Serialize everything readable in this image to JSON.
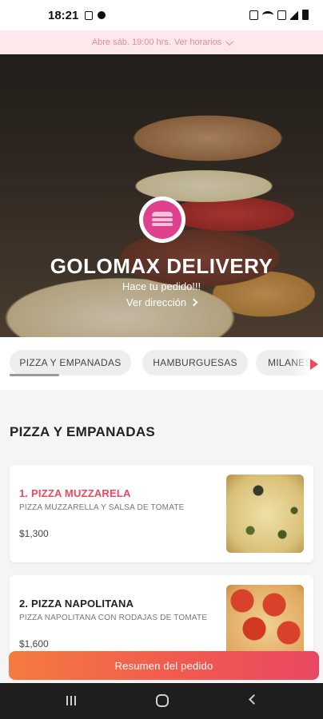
{
  "status_bar": {
    "time": "18:21"
  },
  "hours_bar": {
    "text": "Abre sáb. 19:00 hrs.",
    "link": "Ver horarios"
  },
  "hero": {
    "title": "GOLOMAX DELIVERY",
    "subtitle": "Hace tu pedido!!!",
    "address_link": "Ver dirección"
  },
  "tabs": [
    {
      "label": "PIZZA Y EMPANADAS"
    },
    {
      "label": "HAMBURGUESAS"
    },
    {
      "label": "MILANESAS"
    }
  ],
  "section": {
    "title": "PIZZA Y EMPANADAS"
  },
  "products": [
    {
      "name": "1. PIZZA MUZZARELA",
      "description": "PIZZA MUZZARELLA Y SALSA DE TOMATE",
      "price": "$1,300"
    },
    {
      "name": "2. PIZZA NAPOLITANA",
      "description": "PIZZA NAPOLITANA CON RODAJAS DE TOMATE",
      "price": "$1,600"
    }
  ],
  "order_button": {
    "label": "Resumen del pedido"
  },
  "colors": {
    "accent": "#e84a5f",
    "brand_pink": "#e0418d",
    "hours_bg": "#fde8eb",
    "button_start": "#f47b3f",
    "button_end": "#e94862"
  }
}
